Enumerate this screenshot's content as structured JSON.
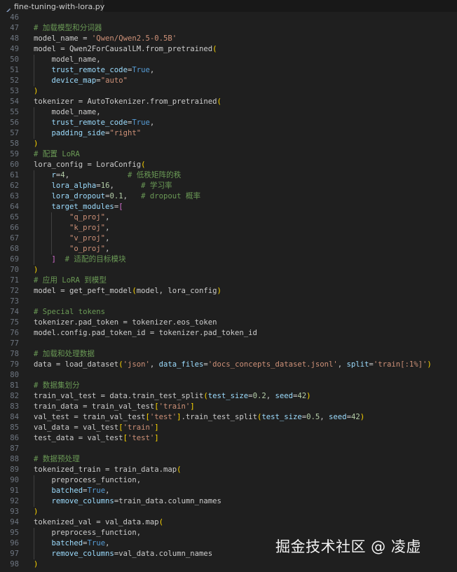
{
  "tab": {
    "filename": "fine-tuning-with-lora.py",
    "icon": "python-file-icon"
  },
  "watermark": "掘金技术社区 @ 凌虚",
  "colors": {
    "background": "#1f1f1f",
    "comment": "#6a9955",
    "string": "#ce9178",
    "keyword": "#569cd6",
    "number": "#b5cea8",
    "attr": "#9cdcfe",
    "bracket1": "#ffd700",
    "bracket2": "#da70d6",
    "line_number": "#6e7681"
  },
  "lines": [
    {
      "n": "46",
      "indent": 0,
      "t": []
    },
    {
      "n": "47",
      "indent": 0,
      "t": [
        [
          "cm",
          "# 加载模型和分词器"
        ]
      ]
    },
    {
      "n": "48",
      "indent": 0,
      "t": [
        [
          "pl",
          "model_name = "
        ],
        [
          "str",
          "'Qwen/Qwen2.5-0.5B'"
        ]
      ]
    },
    {
      "n": "49",
      "indent": 0,
      "t": [
        [
          "pl",
          "model = Qwen2ForCausalLM.from_pretrained"
        ],
        [
          "p1",
          "("
        ]
      ]
    },
    {
      "n": "50",
      "indent": 1,
      "t": [
        [
          "pl",
          "    model_name,"
        ]
      ]
    },
    {
      "n": "51",
      "indent": 1,
      "t": [
        [
          "pl",
          "    "
        ],
        [
          "at",
          "trust_remote_code"
        ],
        [
          "pl",
          "="
        ],
        [
          "kw",
          "True"
        ],
        [
          "pl",
          ","
        ]
      ]
    },
    {
      "n": "52",
      "indent": 1,
      "t": [
        [
          "pl",
          "    "
        ],
        [
          "at",
          "device_map"
        ],
        [
          "pl",
          "="
        ],
        [
          "str",
          "\"auto\""
        ]
      ]
    },
    {
      "n": "53",
      "indent": 0,
      "t": [
        [
          "p1",
          ")"
        ]
      ]
    },
    {
      "n": "54",
      "indent": 0,
      "t": [
        [
          "pl",
          "tokenizer = AutoTokenizer.from_pretrained"
        ],
        [
          "p1",
          "("
        ]
      ]
    },
    {
      "n": "55",
      "indent": 1,
      "t": [
        [
          "pl",
          "    model_name,"
        ]
      ]
    },
    {
      "n": "56",
      "indent": 1,
      "t": [
        [
          "pl",
          "    "
        ],
        [
          "at",
          "trust_remote_code"
        ],
        [
          "pl",
          "="
        ],
        [
          "kw",
          "True"
        ],
        [
          "pl",
          ","
        ]
      ]
    },
    {
      "n": "57",
      "indent": 1,
      "t": [
        [
          "pl",
          "    "
        ],
        [
          "at",
          "padding_side"
        ],
        [
          "pl",
          "="
        ],
        [
          "str",
          "\"right\""
        ]
      ]
    },
    {
      "n": "58",
      "indent": 0,
      "t": [
        [
          "p1",
          ")"
        ]
      ]
    },
    {
      "n": "59",
      "indent": 0,
      "t": [
        [
          "cm",
          "# 配置 LoRA"
        ]
      ]
    },
    {
      "n": "60",
      "indent": 0,
      "t": [
        [
          "pl",
          "lora_config = LoraConfig"
        ],
        [
          "p1",
          "("
        ]
      ]
    },
    {
      "n": "61",
      "indent": 1,
      "t": [
        [
          "pl",
          "    "
        ],
        [
          "at",
          "r"
        ],
        [
          "pl",
          "="
        ],
        [
          "num",
          "4"
        ],
        [
          "pl",
          ",             "
        ],
        [
          "cm",
          "# 低秩矩阵的秩"
        ]
      ]
    },
    {
      "n": "62",
      "indent": 1,
      "t": [
        [
          "pl",
          "    "
        ],
        [
          "at",
          "lora_alpha"
        ],
        [
          "pl",
          "="
        ],
        [
          "num",
          "16"
        ],
        [
          "pl",
          ",      "
        ],
        [
          "cm",
          "# 学习率"
        ]
      ]
    },
    {
      "n": "63",
      "indent": 1,
      "t": [
        [
          "pl",
          "    "
        ],
        [
          "at",
          "lora_dropout"
        ],
        [
          "pl",
          "="
        ],
        [
          "num",
          "0.1"
        ],
        [
          "pl",
          ",   "
        ],
        [
          "cm",
          "# dropout 概率"
        ]
      ]
    },
    {
      "n": "64",
      "indent": 1,
      "t": [
        [
          "pl",
          "    "
        ],
        [
          "at",
          "target_modules"
        ],
        [
          "pl",
          "="
        ],
        [
          "p2",
          "["
        ]
      ]
    },
    {
      "n": "65",
      "indent": 2,
      "t": [
        [
          "pl",
          "        "
        ],
        [
          "str",
          "\"q_proj\""
        ],
        [
          "pl",
          ","
        ]
      ]
    },
    {
      "n": "66",
      "indent": 2,
      "t": [
        [
          "pl",
          "        "
        ],
        [
          "str",
          "\"k_proj\""
        ],
        [
          "pl",
          ","
        ]
      ]
    },
    {
      "n": "67",
      "indent": 2,
      "t": [
        [
          "pl",
          "        "
        ],
        [
          "str",
          "\"v_proj\""
        ],
        [
          "pl",
          ","
        ]
      ]
    },
    {
      "n": "68",
      "indent": 2,
      "t": [
        [
          "pl",
          "        "
        ],
        [
          "str",
          "\"o_proj\""
        ],
        [
          "pl",
          ","
        ]
      ]
    },
    {
      "n": "69",
      "indent": 1,
      "t": [
        [
          "pl",
          "    "
        ],
        [
          "p2",
          "]"
        ],
        [
          "pl",
          "  "
        ],
        [
          "cm",
          "# 适配的目标模块"
        ]
      ]
    },
    {
      "n": "70",
      "indent": 0,
      "t": [
        [
          "p1",
          ")"
        ]
      ]
    },
    {
      "n": "71",
      "indent": 0,
      "t": [
        [
          "cm",
          "# 应用 LoRA 到模型"
        ]
      ]
    },
    {
      "n": "72",
      "indent": 0,
      "t": [
        [
          "pl",
          "model = get_peft_model"
        ],
        [
          "p1",
          "("
        ],
        [
          "pl",
          "model, lora_config"
        ],
        [
          "p1",
          ")"
        ]
      ]
    },
    {
      "n": "73",
      "indent": 0,
      "t": []
    },
    {
      "n": "74",
      "indent": 0,
      "t": [
        [
          "cm",
          "# Special tokens"
        ]
      ]
    },
    {
      "n": "75",
      "indent": 0,
      "t": [
        [
          "pl",
          "tokenizer.pad_token = tokenizer.eos_token"
        ]
      ]
    },
    {
      "n": "76",
      "indent": 0,
      "t": [
        [
          "pl",
          "model.config.pad_token_id = tokenizer.pad_token_id"
        ]
      ]
    },
    {
      "n": "77",
      "indent": 0,
      "t": []
    },
    {
      "n": "78",
      "indent": 0,
      "t": [
        [
          "cm",
          "# 加载和处理数据"
        ]
      ]
    },
    {
      "n": "79",
      "indent": 0,
      "t": [
        [
          "pl",
          "data = load_dataset"
        ],
        [
          "p1",
          "("
        ],
        [
          "str",
          "'json'"
        ],
        [
          "pl",
          ", "
        ],
        [
          "at",
          "data_files"
        ],
        [
          "pl",
          "="
        ],
        [
          "str",
          "'docs_concepts_dataset.jsonl'"
        ],
        [
          "pl",
          ", "
        ],
        [
          "at",
          "split"
        ],
        [
          "pl",
          "="
        ],
        [
          "str",
          "'train[:1%]'"
        ],
        [
          "p1",
          ")"
        ]
      ]
    },
    {
      "n": "80",
      "indent": 0,
      "t": []
    },
    {
      "n": "81",
      "indent": 0,
      "t": [
        [
          "cm",
          "# 数据集划分"
        ]
      ]
    },
    {
      "n": "82",
      "indent": 0,
      "t": [
        [
          "pl",
          "train_val_test = data.train_test_split"
        ],
        [
          "p1",
          "("
        ],
        [
          "at",
          "test_size"
        ],
        [
          "pl",
          "="
        ],
        [
          "num",
          "0.2"
        ],
        [
          "pl",
          ", "
        ],
        [
          "at",
          "seed"
        ],
        [
          "pl",
          "="
        ],
        [
          "num",
          "42"
        ],
        [
          "p1",
          ")"
        ]
      ]
    },
    {
      "n": "83",
      "indent": 0,
      "t": [
        [
          "pl",
          "train_data = train_val_test"
        ],
        [
          "p1",
          "["
        ],
        [
          "str",
          "'train'"
        ],
        [
          "p1",
          "]"
        ]
      ]
    },
    {
      "n": "84",
      "indent": 0,
      "t": [
        [
          "pl",
          "val_test = train_val_test"
        ],
        [
          "p1",
          "["
        ],
        [
          "str",
          "'test'"
        ],
        [
          "p1",
          "]"
        ],
        [
          "pl",
          ".train_test_split"
        ],
        [
          "p1",
          "("
        ],
        [
          "at",
          "test_size"
        ],
        [
          "pl",
          "="
        ],
        [
          "num",
          "0.5"
        ],
        [
          "pl",
          ", "
        ],
        [
          "at",
          "seed"
        ],
        [
          "pl",
          "="
        ],
        [
          "num",
          "42"
        ],
        [
          "p1",
          ")"
        ]
      ]
    },
    {
      "n": "85",
      "indent": 0,
      "t": [
        [
          "pl",
          "val_data = val_test"
        ],
        [
          "p1",
          "["
        ],
        [
          "str",
          "'train'"
        ],
        [
          "p1",
          "]"
        ]
      ]
    },
    {
      "n": "86",
      "indent": 0,
      "t": [
        [
          "pl",
          "test_data = val_test"
        ],
        [
          "p1",
          "["
        ],
        [
          "str",
          "'test'"
        ],
        [
          "p1",
          "]"
        ]
      ]
    },
    {
      "n": "87",
      "indent": 0,
      "t": []
    },
    {
      "n": "88",
      "indent": 0,
      "t": [
        [
          "cm",
          "# 数据预处理"
        ]
      ]
    },
    {
      "n": "89",
      "indent": 0,
      "t": [
        [
          "pl",
          "tokenized_train = train_data.map"
        ],
        [
          "p1",
          "("
        ]
      ]
    },
    {
      "n": "90",
      "indent": 1,
      "t": [
        [
          "pl",
          "    preprocess_function,"
        ]
      ]
    },
    {
      "n": "91",
      "indent": 1,
      "t": [
        [
          "pl",
          "    "
        ],
        [
          "at",
          "batched"
        ],
        [
          "pl",
          "="
        ],
        [
          "kw",
          "True"
        ],
        [
          "pl",
          ","
        ]
      ]
    },
    {
      "n": "92",
      "indent": 1,
      "t": [
        [
          "pl",
          "    "
        ],
        [
          "at",
          "remove_columns"
        ],
        [
          "pl",
          "=train_data.column_names"
        ]
      ]
    },
    {
      "n": "93",
      "indent": 0,
      "t": [
        [
          "p1",
          ")"
        ]
      ]
    },
    {
      "n": "94",
      "indent": 0,
      "t": [
        [
          "pl",
          "tokenized_val = val_data.map"
        ],
        [
          "p1",
          "("
        ]
      ]
    },
    {
      "n": "95",
      "indent": 1,
      "t": [
        [
          "pl",
          "    preprocess_function,"
        ]
      ]
    },
    {
      "n": "96",
      "indent": 1,
      "t": [
        [
          "pl",
          "    "
        ],
        [
          "at",
          "batched"
        ],
        [
          "pl",
          "="
        ],
        [
          "kw",
          "True"
        ],
        [
          "pl",
          ","
        ]
      ]
    },
    {
      "n": "97",
      "indent": 1,
      "t": [
        [
          "pl",
          "    "
        ],
        [
          "at",
          "remove_columns"
        ],
        [
          "pl",
          "=val_data.column_names"
        ]
      ]
    },
    {
      "n": "98",
      "indent": 0,
      "t": [
        [
          "p1",
          ")"
        ]
      ]
    }
  ]
}
